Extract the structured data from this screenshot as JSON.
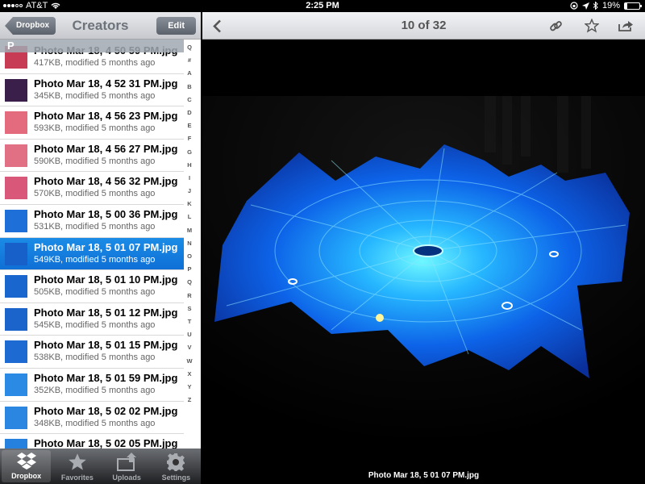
{
  "status": {
    "carrier": "AT&T",
    "time": "2:25 PM",
    "battery": "19%",
    "battery_fraction": 0.19
  },
  "left": {
    "back_label": "Dropbox",
    "title": "Creators",
    "edit_label": "Edit",
    "section_letter": "P",
    "rows": [
      {
        "name": "Photo Mar 18, 4 50 59 PM.jpg",
        "meta": "417KB, modified 5 months ago",
        "thumb": "#c83b55"
      },
      {
        "name": "Photo Mar 18, 4 52 31 PM.jpg",
        "meta": "345KB, modified 5 months ago",
        "thumb": "#3a1f4a"
      },
      {
        "name": "Photo Mar 18, 4 56 23 PM.jpg",
        "meta": "593KB, modified 5 months ago",
        "thumb": "#e46a7e"
      },
      {
        "name": "Photo Mar 18, 4 56 27 PM.jpg",
        "meta": "590KB, modified 5 months ago",
        "thumb": "#e27084"
      },
      {
        "name": "Photo Mar 18, 4 56 32 PM.jpg",
        "meta": "570KB, modified 5 months ago",
        "thumb": "#d9587a"
      },
      {
        "name": "Photo Mar 18, 5 00 36 PM.jpg",
        "meta": "531KB, modified 5 months ago",
        "thumb": "#1f6fd8"
      },
      {
        "name": "Photo Mar 18, 5 01 07 PM.jpg",
        "meta": "549KB, modified 5 months ago",
        "thumb": "#1760c9",
        "selected": true
      },
      {
        "name": "Photo Mar 18, 5 01 10 PM.jpg",
        "meta": "505KB, modified 5 months ago",
        "thumb": "#1a66cf"
      },
      {
        "name": "Photo Mar 18, 5 01 12 PM.jpg",
        "meta": "545KB, modified 5 months ago",
        "thumb": "#1b64cc"
      },
      {
        "name": "Photo Mar 18, 5 01 15 PM.jpg",
        "meta": "538KB, modified 5 months ago",
        "thumb": "#1c6ad2"
      },
      {
        "name": "Photo Mar 18, 5 01 59 PM.jpg",
        "meta": "352KB, modified 5 months ago",
        "thumb": "#2b8ae3"
      },
      {
        "name": "Photo Mar 18, 5 02 02 PM.jpg",
        "meta": "348KB, modified 5 months ago",
        "thumb": "#2a86e0"
      },
      {
        "name": "Photo Mar 18, 5 02 05 PM.jpg",
        "meta": "",
        "thumb": "#2681de"
      }
    ],
    "index_letters": [
      "Q",
      "#",
      "A",
      "B",
      "C",
      "D",
      "E",
      "F",
      "G",
      "H",
      "I",
      "J",
      "K",
      "L",
      "M",
      "N",
      "O",
      "P",
      "Q",
      "R",
      "S",
      "T",
      "U",
      "V",
      "W",
      "X",
      "Y",
      "Z"
    ],
    "tabs": [
      {
        "label": "Dropbox",
        "icon": "dropbox-icon",
        "active": true
      },
      {
        "label": "Favorites",
        "icon": "star-icon"
      },
      {
        "label": "Uploads",
        "icon": "upload-icon"
      },
      {
        "label": "Settings",
        "icon": "gear-icon"
      }
    ]
  },
  "viewer": {
    "title": "10 of 32",
    "caption": "Photo Mar 18, 5 01 07 PM.jpg"
  },
  "colors": {
    "selected_row": "#0f6fd6",
    "photo_blue": "#1d8cff"
  }
}
